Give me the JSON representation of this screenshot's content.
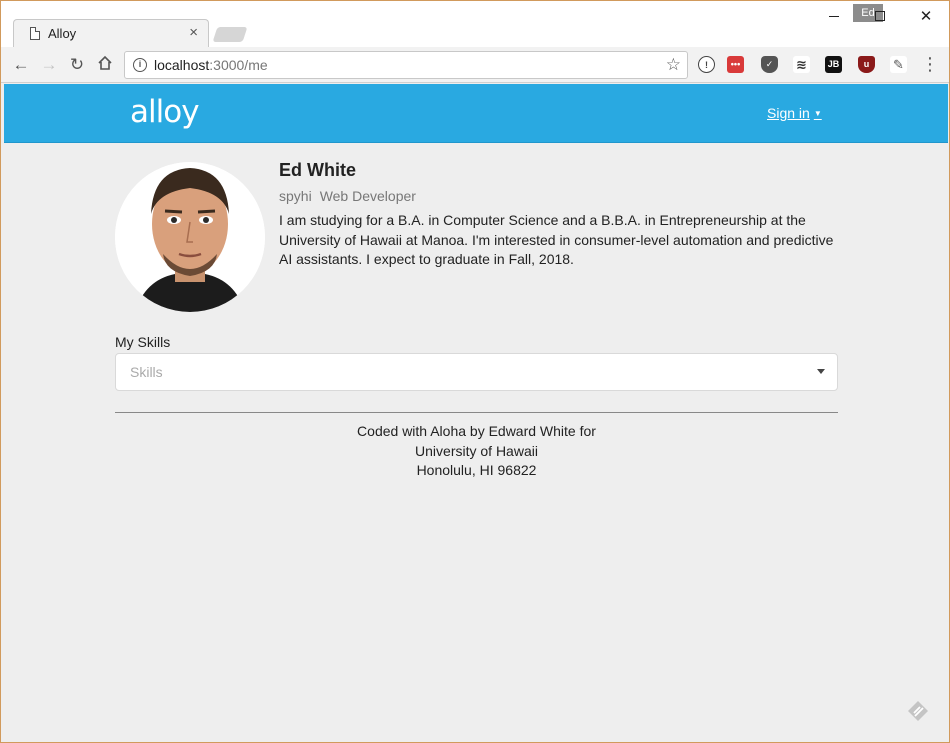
{
  "browser": {
    "tab_title": "Alloy",
    "tab_close": "×",
    "user_chip": "Ed",
    "url_host": "localhost",
    "url_path": ":3000/me",
    "win_close": "✕"
  },
  "nav": {
    "logo": "alloy",
    "signin": "Sign in"
  },
  "profile": {
    "name": "Ed White",
    "username": "spyhi",
    "title": "Web Developer",
    "bio": "I am studying for a B.A. in Computer Science and a B.B.A. in Entrepreneurship at the University of Hawaii at Manoa. I'm interested in consumer-level automation and predictive AI assistants. I expect to graduate in Fall, 2018."
  },
  "skills": {
    "label": "My Skills",
    "placeholder": "Skills"
  },
  "footer": {
    "line1": "Coded with Aloha by Edward White for",
    "line2": "University of Hawaii",
    "line3": "Honolulu, HI 96822"
  },
  "colors": {
    "navbar": "#29a9e1",
    "page_background": "#eeeeee"
  }
}
